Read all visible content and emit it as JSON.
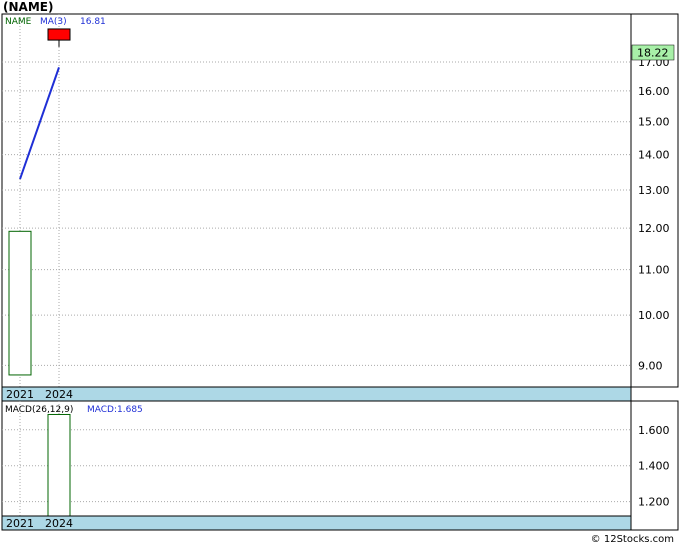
{
  "title": "(NAME)",
  "footer": "© 12Stocks.com",
  "colors": {
    "up_candle": "#006400",
    "down_candle": "#ff0000",
    "ma_line": "#1f2fd6",
    "date_band": "#add8e6",
    "price_badge": "#a8f0a8",
    "legend_name": "#006400",
    "legend_ma": "#1f2fd6",
    "grid": "#aaaaaa"
  },
  "chart_data": [
    {
      "type": "candlestick",
      "panel": "price",
      "legend": {
        "name": "NAME",
        "ma_label": "MA(3)",
        "ma_value": "16.81"
      },
      "last_price_label": "18.22",
      "x_ticks": [
        "2021",
        "2024"
      ],
      "y_ticks": [
        9.0,
        10.0,
        11.0,
        12.0,
        13.0,
        14.0,
        15.0,
        16.0,
        17.0
      ],
      "y_tick_labels": [
        "9.00",
        "10.00",
        "11.00",
        "12.00",
        "13.00",
        "14.00",
        "15.00",
        "16.00",
        "17.00"
      ],
      "ylim": [
        8.6,
        18.8
      ],
      "log_scale": true,
      "grid": true,
      "candles": [
        {
          "x": "2021",
          "open": 8.82,
          "high": 11.92,
          "low": 8.82,
          "close": 11.92
        },
        {
          "x": "2024",
          "open": 18.22,
          "high": 18.22,
          "low": 17.55,
          "close": 17.8
        }
      ],
      "ma": {
        "name": "MA(3)",
        "points": [
          {
            "x": "2021",
            "y": 13.3
          },
          {
            "x": "2024",
            "y": 16.81
          }
        ]
      }
    },
    {
      "type": "bar",
      "panel": "macd",
      "legend": {
        "name": "MACD(26,12,9)",
        "value_label": "MACD:1.685"
      },
      "x_ticks": [
        "2021",
        "2024"
      ],
      "y_ticks": [
        1.2,
        1.4,
        1.6
      ],
      "y_tick_labels": [
        "1.200",
        "1.400",
        "1.600"
      ],
      "ylim": [
        1.12,
        1.76
      ],
      "grid": true,
      "bars": [
        {
          "x": "2024",
          "value": 1.685
        }
      ]
    }
  ]
}
